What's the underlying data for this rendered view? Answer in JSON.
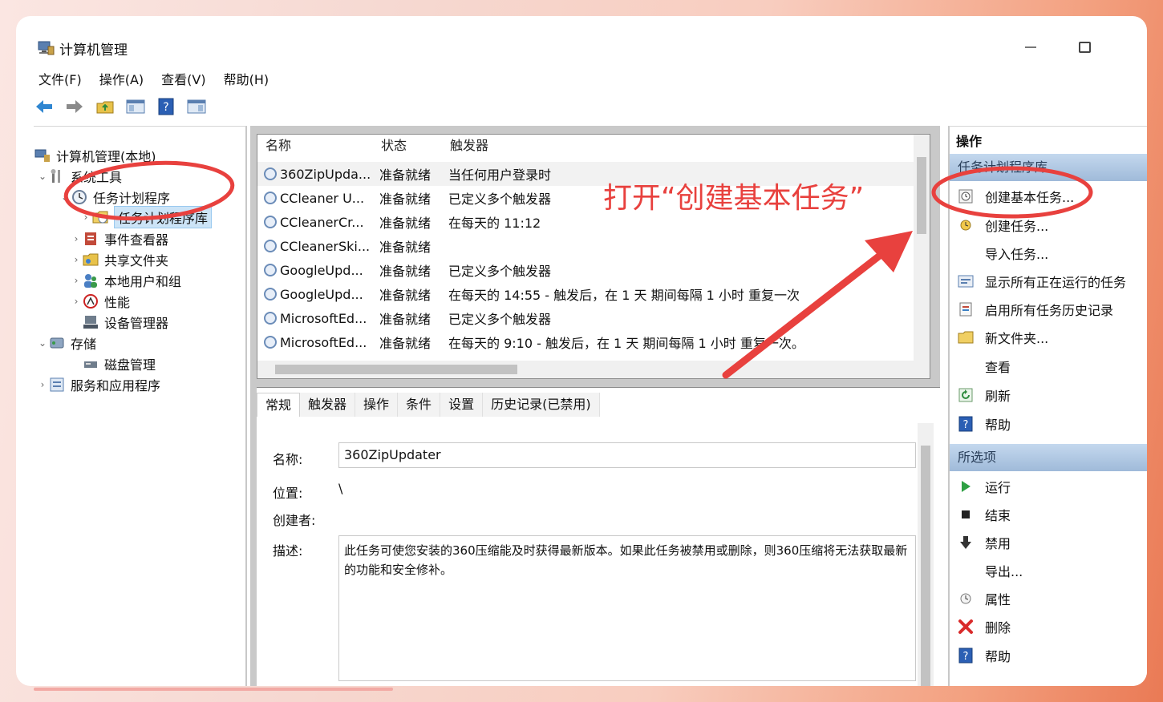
{
  "window": {
    "title": "计算机管理",
    "menu": [
      "文件(F)",
      "操作(A)",
      "查看(V)",
      "帮助(H)"
    ]
  },
  "tree": {
    "items": [
      {
        "label": "计算机管理(本地)"
      },
      {
        "label": "系统工具"
      },
      {
        "label": "任务计划程序"
      },
      {
        "label": "任务计划程序库"
      },
      {
        "label": "事件查看器"
      },
      {
        "label": "共享文件夹"
      },
      {
        "label": "本地用户和组"
      },
      {
        "label": "性能"
      },
      {
        "label": "设备管理器"
      },
      {
        "label": "存储"
      },
      {
        "label": "磁盘管理"
      },
      {
        "label": "服务和应用程序"
      }
    ]
  },
  "task_list": {
    "headers": [
      "名称",
      "状态",
      "触发器"
    ],
    "rows": [
      {
        "name": "360ZipUpda...",
        "status": "准备就绪",
        "trigger": "当任何用户登录时"
      },
      {
        "name": "CCleaner U...",
        "status": "准备就绪",
        "trigger": "已定义多个触发器"
      },
      {
        "name": "CCleanerCr...",
        "status": "准备就绪",
        "trigger": "在每天的 11:12"
      },
      {
        "name": "CCleanerSki...",
        "status": "准备就绪",
        "trigger": ""
      },
      {
        "name": "GoogleUpd...",
        "status": "准备就绪",
        "trigger": "已定义多个触发器"
      },
      {
        "name": "GoogleUpd...",
        "status": "准备就绪",
        "trigger": "在每天的 14:55 - 触发后，在 1 天 期间每隔 1 小时 重复一次"
      },
      {
        "name": "MicrosoftEd...",
        "status": "准备就绪",
        "trigger": "已定义多个触发器"
      },
      {
        "name": "MicrosoftEd...",
        "status": "准备就绪",
        "trigger": "在每天的 9:10 - 触发后，在 1 天 期间每隔 1 小时 重复一次。"
      }
    ]
  },
  "details": {
    "tabs": [
      "常规",
      "触发器",
      "操作",
      "条件",
      "设置",
      "历史记录(已禁用)"
    ],
    "name_label": "名称:",
    "name_value": "360ZipUpdater",
    "location_label": "位置:",
    "location_value": "\\",
    "author_label": "创建者:",
    "description_label": "描述:",
    "description_value": "此任务可使您安装的360压缩能及时获得最新版本。如果此任务被禁用或删除，则360压缩将无法获取最新的功能和安全修补。"
  },
  "actions": {
    "header": "操作",
    "section1": "任务计划程序库",
    "items1": [
      {
        "label": "创建基本任务...",
        "icon": "basic-task-icon"
      },
      {
        "label": "创建任务...",
        "icon": "create-task-icon"
      },
      {
        "label": "导入任务...",
        "icon": ""
      },
      {
        "label": "显示所有正在运行的任务",
        "icon": "running-tasks-icon"
      },
      {
        "label": "启用所有任务历史记录",
        "icon": "history-icon"
      },
      {
        "label": "新文件夹...",
        "icon": "folder-icon"
      },
      {
        "label": "查看",
        "icon": ""
      },
      {
        "label": "刷新",
        "icon": "refresh-icon"
      },
      {
        "label": "帮助",
        "icon": "help-icon"
      }
    ],
    "section2": "所选项",
    "items2": [
      {
        "label": "运行",
        "icon": "run-icon"
      },
      {
        "label": "结束",
        "icon": "stop-icon"
      },
      {
        "label": "禁用",
        "icon": "disable-icon"
      },
      {
        "label": "导出...",
        "icon": ""
      },
      {
        "label": "属性",
        "icon": "properties-icon"
      },
      {
        "label": "删除",
        "icon": "delete-icon"
      },
      {
        "label": "帮助",
        "icon": "help-icon"
      }
    ]
  },
  "annotation": {
    "text": "打开“创建基本任务”",
    "color": "#e8413e"
  }
}
